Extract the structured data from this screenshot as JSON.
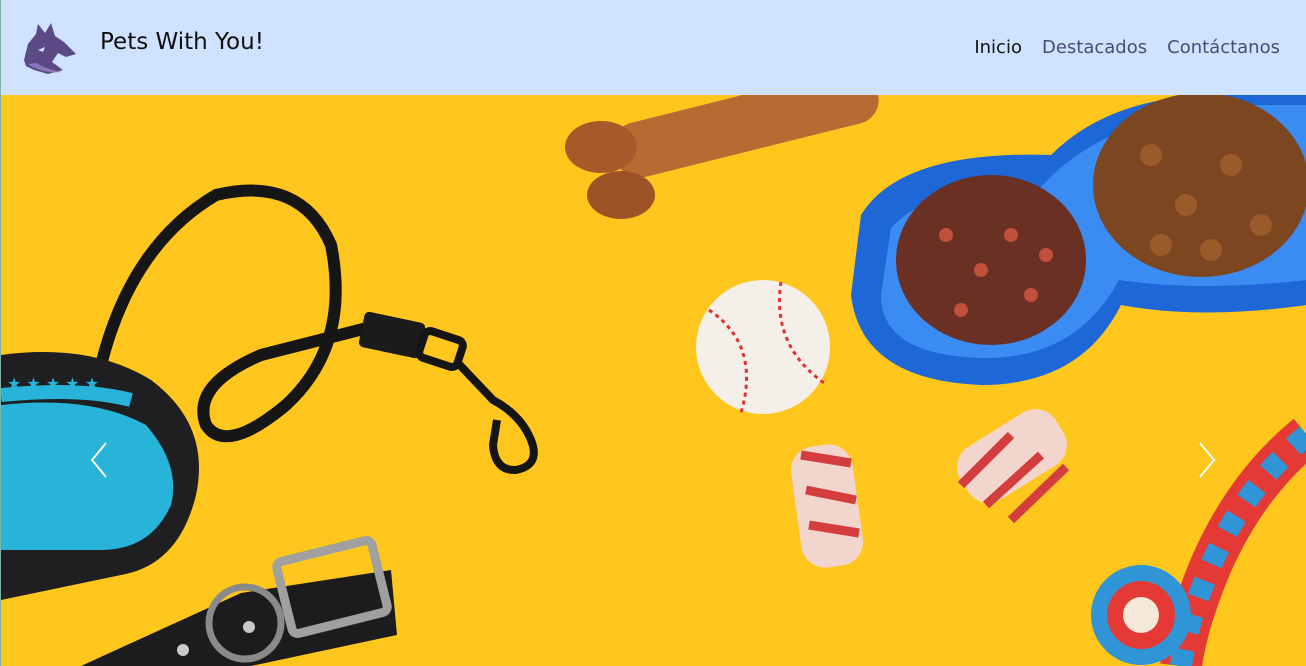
{
  "brand": {
    "name": "Pets With You!",
    "logo_icon": "wolf-head-logo"
  },
  "nav": {
    "links": [
      {
        "label": "Inicio",
        "active": true
      },
      {
        "label": "Destacados",
        "active": false
      },
      {
        "label": "Contáctanos",
        "active": false
      }
    ]
  },
  "carousel": {
    "prev_icon": "chevron-left-icon",
    "next_icon": "chevron-right-icon"
  },
  "colors": {
    "navbar_bg": "#cfe2ff",
    "hero_bg": "#ffc61e",
    "link_text": "#4a4f67",
    "active_link_text": "#111111"
  }
}
